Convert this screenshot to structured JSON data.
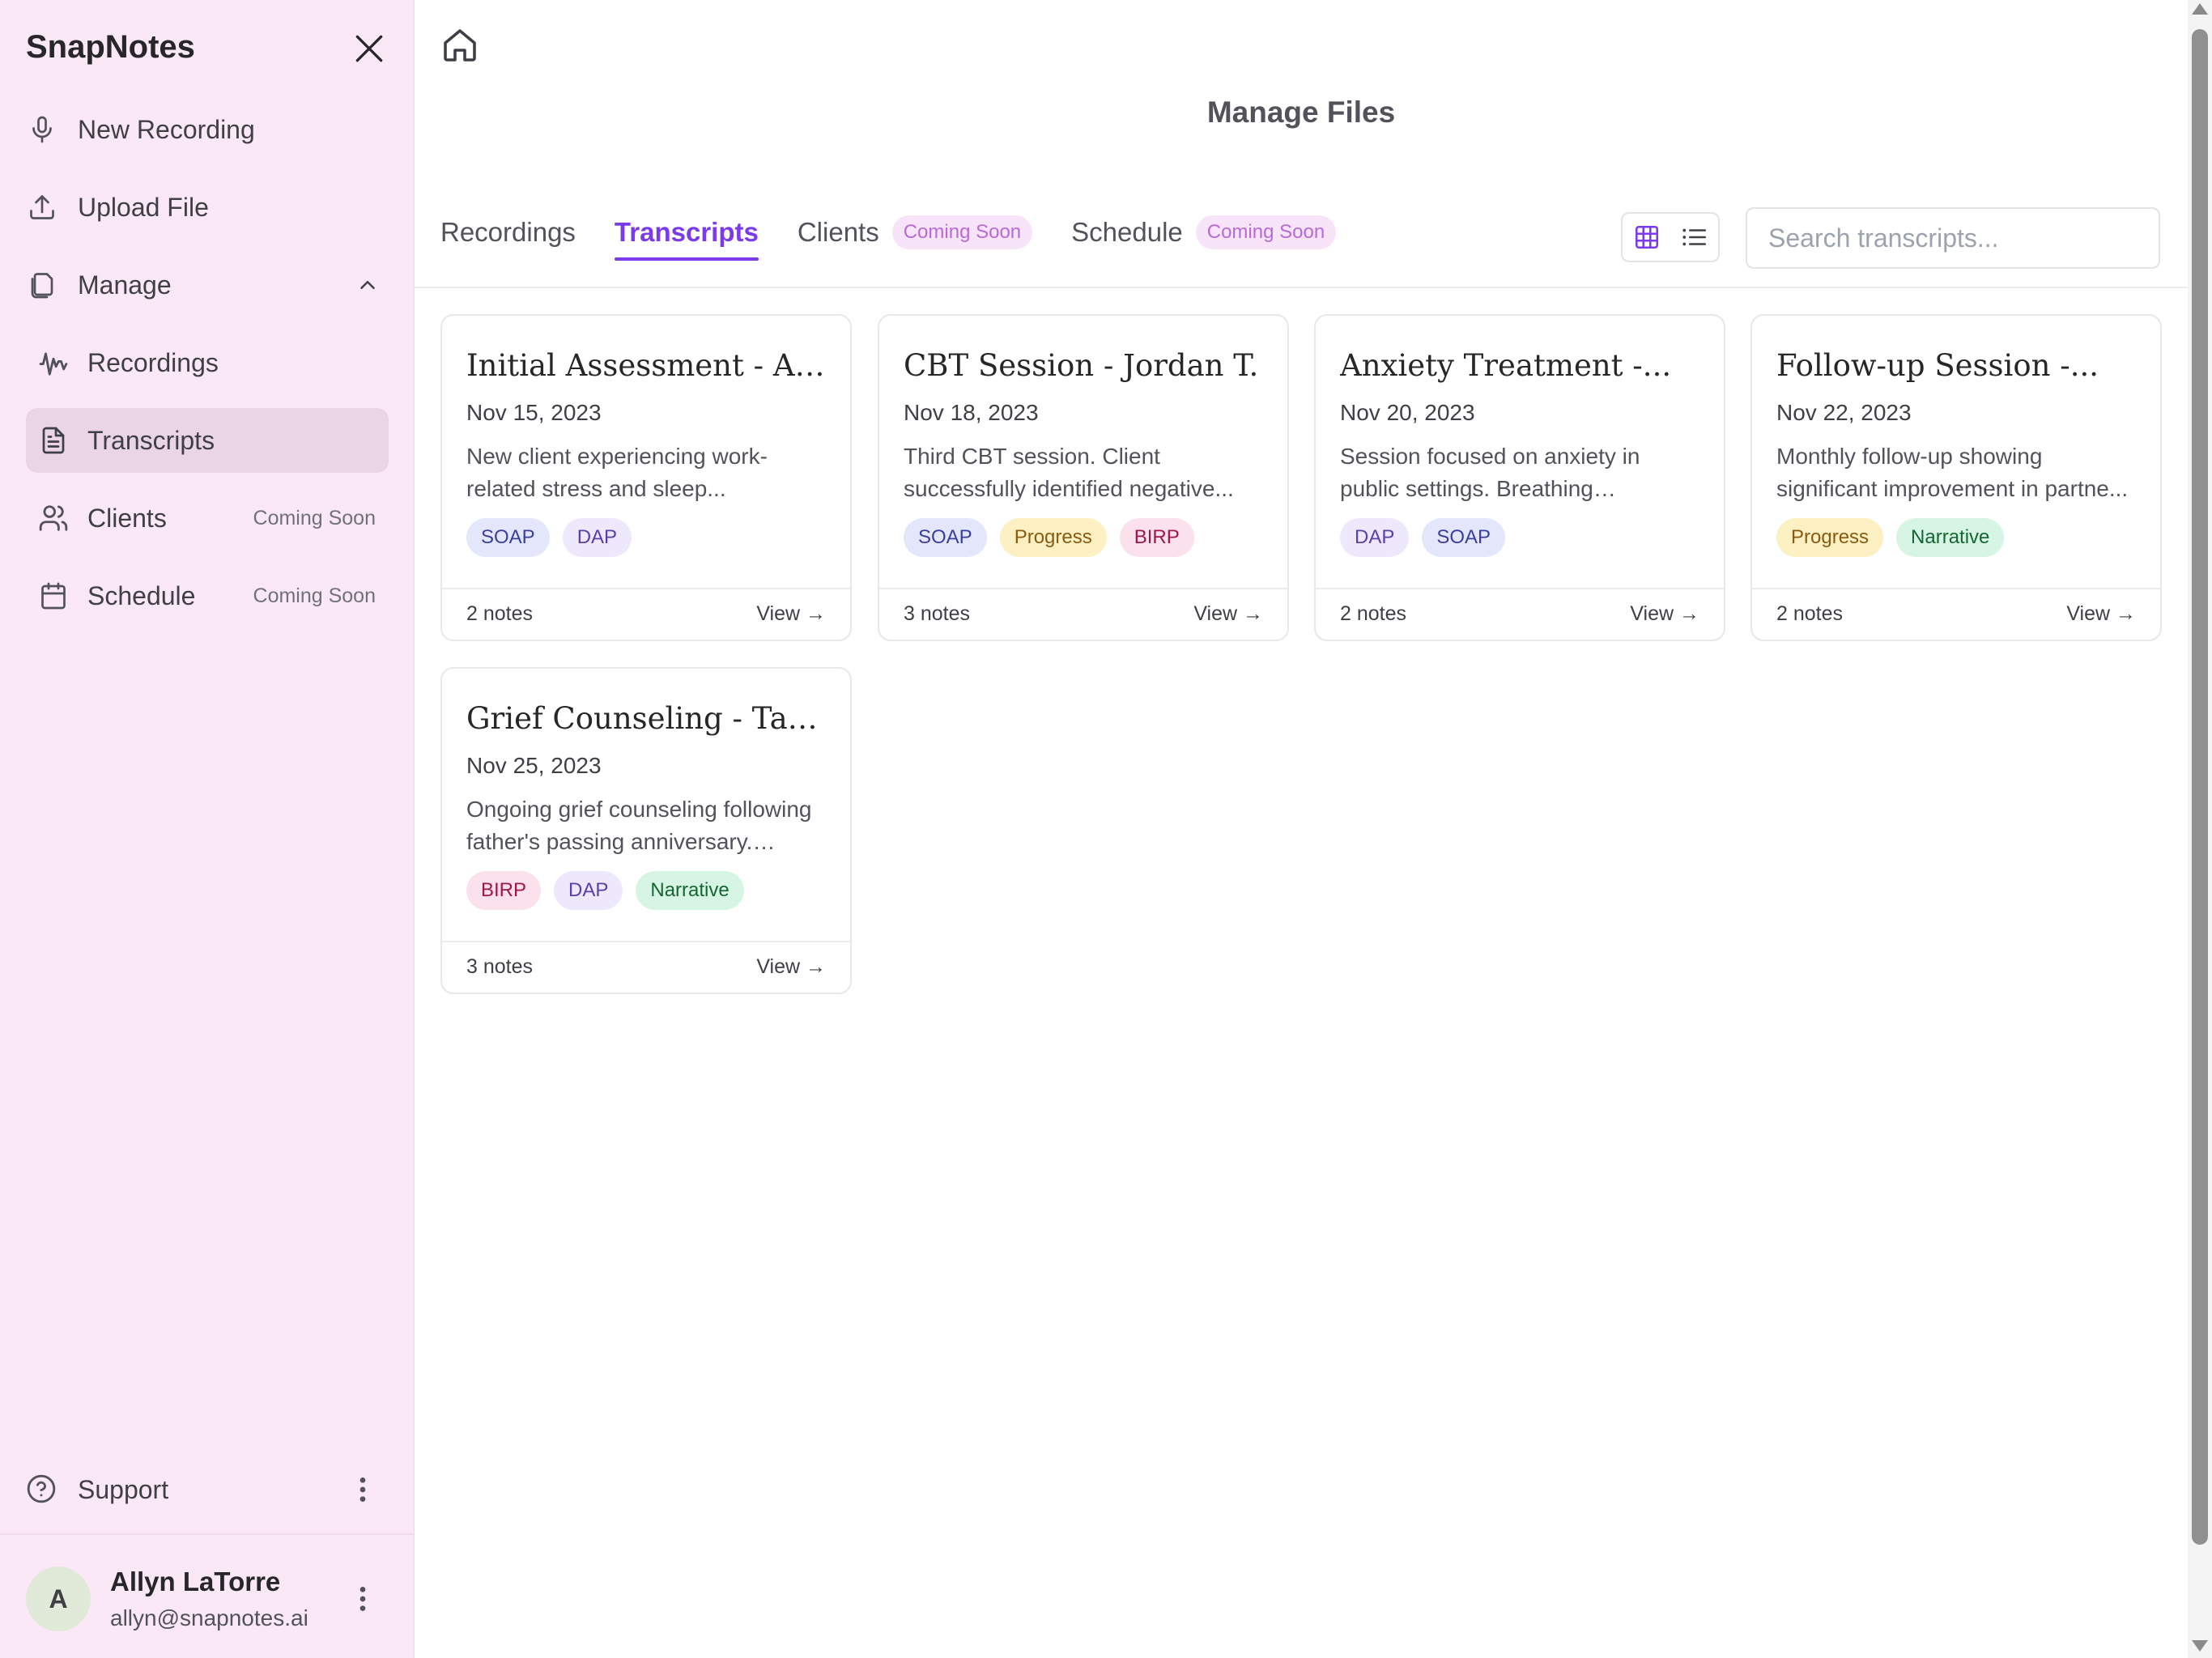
{
  "app": {
    "name": "SnapNotes"
  },
  "sidebar": {
    "items": [
      {
        "label": "New Recording",
        "icon": "microphone-icon"
      },
      {
        "label": "Upload File",
        "icon": "upload-icon"
      },
      {
        "label": "Manage",
        "icon": "files-icon",
        "expanded": true
      },
      {
        "label": "Recordings",
        "icon": "waveform-icon"
      },
      {
        "label": "Transcripts",
        "icon": "document-icon",
        "active": true
      },
      {
        "label": "Clients",
        "icon": "users-icon",
        "badge": "Coming Soon"
      },
      {
        "label": "Schedule",
        "icon": "calendar-icon",
        "badge": "Coming Soon"
      }
    ],
    "support_label": "Support"
  },
  "user": {
    "initial": "A",
    "name": "Allyn LaTorre",
    "email": "allyn@snapnotes.ai"
  },
  "page": {
    "title": "Manage Files"
  },
  "tabs": [
    {
      "label": "Recordings"
    },
    {
      "label": "Transcripts",
      "active": true
    },
    {
      "label": "Clients",
      "badge": "Coming Soon"
    },
    {
      "label": "Schedule",
      "badge": "Coming Soon"
    }
  ],
  "search": {
    "placeholder": "Search transcripts...",
    "value": ""
  },
  "view_mode": "grid",
  "colors": {
    "accent": "#7c3aed",
    "sidebar_bg": "#fbe8f6",
    "active_item_bg": "#ead5e6"
  },
  "cards": [
    {
      "title": "Initial Assessment - Al...",
      "date": "Nov 15, 2023",
      "description": "New client experiencing work-related stress and sleep...",
      "tags": [
        "SOAP",
        "DAP"
      ],
      "notes": "2 notes",
      "view_label": "View →"
    },
    {
      "title": "CBT Session - Jordan T.",
      "date": "Nov 18, 2023",
      "description": "Third CBT session. Client successfully identified negative...",
      "tags": [
        "SOAP",
        "Progress",
        "BIRP"
      ],
      "notes": "3 notes",
      "view_label": "View →"
    },
    {
      "title": "Anxiety Treatment -...",
      "date": "Nov 20, 2023",
      "description": "Session focused on anxiety in public settings. Breathing exercise...",
      "tags": [
        "DAP",
        "SOAP"
      ],
      "notes": "2 notes",
      "view_label": "View →"
    },
    {
      "title": "Follow-up Session -...",
      "date": "Nov 22, 2023",
      "description": "Monthly follow-up showing significant improvement in partne...",
      "tags": [
        "Progress",
        "Narrative"
      ],
      "notes": "2 notes",
      "view_label": "View →"
    },
    {
      "title": "Grief Counseling - Tayl...",
      "date": "Nov 25, 2023",
      "description": "Ongoing grief counseling following father's passing anniversary. Clien...",
      "tags": [
        "BIRP",
        "DAP",
        "Narrative"
      ],
      "notes": "3 notes",
      "view_label": "View →"
    }
  ]
}
